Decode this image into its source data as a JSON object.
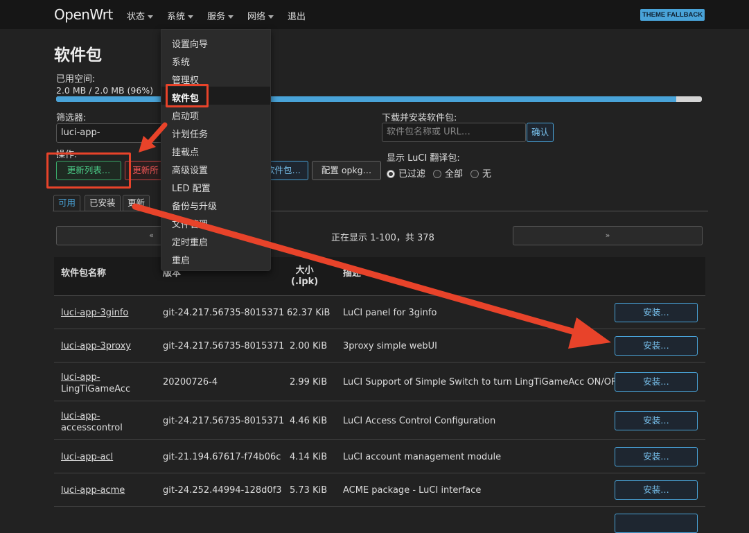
{
  "brand": "OpenWrt",
  "nav": [
    "状态",
    "系统",
    "服务",
    "网络",
    "退出"
  ],
  "theme_badge": "THEME FALLBACK",
  "page_title": "软件包",
  "space": {
    "label": "已用空间:",
    "value": "2.0 MB / 2.0 MB (96%)",
    "percent": 96
  },
  "filter": {
    "label": "筛选器:",
    "value": "luci-app-"
  },
  "download": {
    "label": "下载并安装软件包:",
    "placeholder": "软件包名称或 URL…",
    "confirm": "确认"
  },
  "actions": {
    "label": "操作:",
    "update_list": "更新列表…",
    "upgrade": "更新所",
    "upload": "软件包…",
    "configure": "配置 opkg…"
  },
  "luci_trans": {
    "label": "显示 LuCI 翻译包:",
    "options": [
      "已过滤",
      "全部",
      "无"
    ],
    "selected": "已过滤"
  },
  "tabs": [
    "可用",
    "已安装",
    "更新"
  ],
  "pager": {
    "prev": "«",
    "next": "»",
    "status": "正在显示 1-100，共 378"
  },
  "table": {
    "headers": {
      "name": "软件包名称",
      "version": "版本",
      "size": "大小\n(.ipk)",
      "desc": "描述"
    },
    "install_label": "安装…",
    "rows": [
      {
        "name1": "luci-app-3ginfo",
        "name2": "",
        "version": "git-24.217.56735-8015371",
        "size": "62.37 KiB",
        "desc": "LuCI panel for 3ginfo"
      },
      {
        "name1": "luci-app-3proxy",
        "name2": "",
        "version": "git-24.217.56735-8015371",
        "size": "2.00 KiB",
        "desc": "3proxy simple webUI"
      },
      {
        "name1": "luci-app-",
        "name2": "LingTiGameAcc",
        "version": "20200726-4",
        "size": "2.99 KiB",
        "desc": "LuCI Support of Simple Switch to turn LingTiGameAcc ON/OFF"
      },
      {
        "name1": "luci-app-",
        "name2": "accesscontrol",
        "version": "git-24.217.56735-8015371",
        "size": "4.46 KiB",
        "desc": "LuCI Access Control Configuration"
      },
      {
        "name1": "luci-app-acl",
        "name2": "",
        "version": "git-21.194.67617-f74b06c",
        "size": "4.14 KiB",
        "desc": "LuCI account management module"
      },
      {
        "name1": "luci-app-acme",
        "name2": "",
        "version": "git-24.252.44994-128d0f3",
        "size": "5.73 KiB",
        "desc": "ACME package - LuCI interface"
      }
    ]
  },
  "system_menu": [
    "设置向导",
    "系统",
    "管理权",
    "软件包",
    "启动项",
    "计划任务",
    "挂载点",
    "高级设置",
    "LED 配置",
    "备份与升级",
    "文件管理",
    "定时重启",
    "重启"
  ],
  "system_menu_active": "软件包",
  "colors": {
    "accent": "#49a3d8",
    "annotation": "#e8432a",
    "success": "#3aaa6a",
    "danger": "#cc4444"
  }
}
